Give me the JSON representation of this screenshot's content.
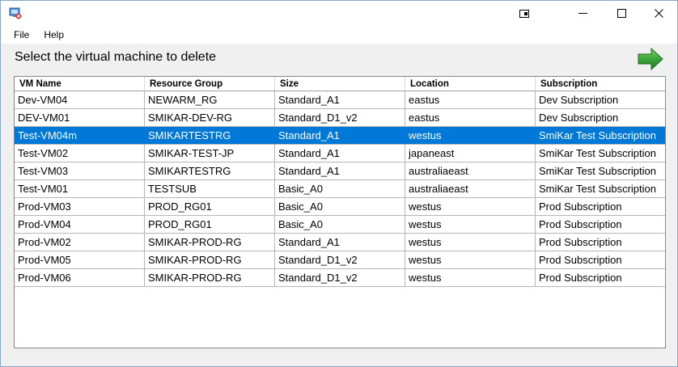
{
  "window": {
    "title": ""
  },
  "menu": {
    "items": [
      "File",
      "Help"
    ]
  },
  "main": {
    "heading": "Select the virtual machine to delete"
  },
  "grid": {
    "columns": [
      "VM Name",
      "Resource Group",
      "Size",
      "Location",
      "Subscription"
    ],
    "rows": [
      [
        "Dev-VM04",
        "NEWARM_RG",
        "Standard_A1",
        "eastus",
        "Dev Subscription"
      ],
      [
        "DEV-VM01",
        "SMIKAR-DEV-RG",
        "Standard_D1_v2",
        "eastus",
        "Dev Subscription"
      ],
      [
        "Test-VM04m",
        "SMIKARTESTRG",
        "Standard_A1",
        "westus",
        "SmiKar Test Subscription"
      ],
      [
        "Test-VM02",
        "SMIKAR-TEST-JP",
        "Standard_A1",
        "japaneast",
        "SmiKar Test Subscription"
      ],
      [
        "Test-VM03",
        "SMIKARTESTRG",
        "Standard_A1",
        "australiaeast",
        "SmiKar Test Subscription"
      ],
      [
        "Test-VM01",
        "TESTSUB",
        "Basic_A0",
        "australiaeast",
        "SmiKar Test Subscription"
      ],
      [
        "Prod-VM03",
        "PROD_RG01",
        "Basic_A0",
        "westus",
        "Prod Subscription"
      ],
      [
        "Prod-VM04",
        "PROD_RG01",
        "Basic_A0",
        "westus",
        "Prod Subscription"
      ],
      [
        "Prod-VM02",
        "SMIKAR-PROD-RG",
        "Standard_A1",
        "westus",
        "Prod Subscription"
      ],
      [
        "Prod-VM05",
        "SMIKAR-PROD-RG",
        "Standard_D1_v2",
        "westus",
        "Prod Subscription"
      ],
      [
        "Prod-VM06",
        "SMIKAR-PROD-RG",
        "Standard_D1_v2",
        "westus",
        "Prod Subscription"
      ]
    ],
    "selected_row": 2
  },
  "colors": {
    "selection": "#0078d7",
    "arrow": "#3aa53a"
  },
  "icons": {
    "app": "azure-vm-delete-icon",
    "next": "green-right-arrow-icon",
    "minimize": "minimize-icon",
    "maximize": "maximize-icon",
    "close": "close-icon",
    "snap": "tablet-mode-icon"
  }
}
